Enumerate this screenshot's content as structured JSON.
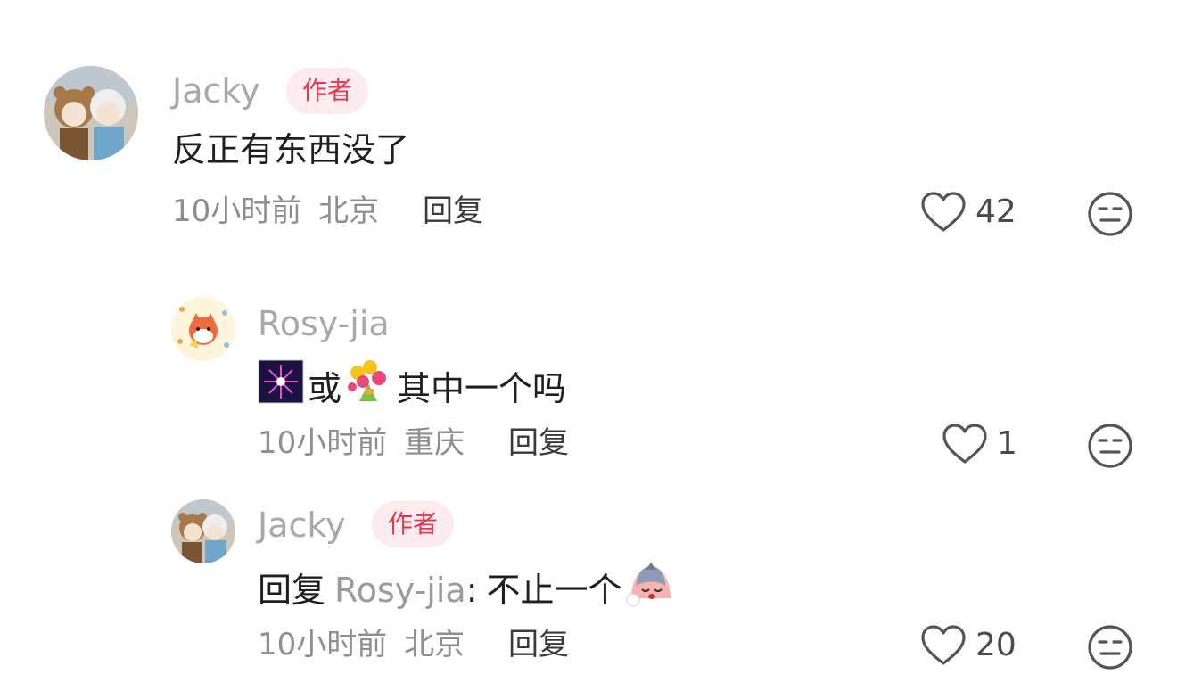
{
  "comments": [
    {
      "author": "Jacky",
      "badge": "作者",
      "text": "反正有东西没了",
      "time": "10小时前",
      "location": "北京",
      "reply_label": "回复",
      "likes": "42"
    },
    {
      "author": "Rosy-jia",
      "text_part1": "或",
      "text_part2": "其中一个吗",
      "time": "10小时前",
      "location": "重庆",
      "reply_label": "回复",
      "likes": "1"
    },
    {
      "author": "Jacky",
      "badge": "作者",
      "reply_prefix": "回复",
      "reply_to": "Rosy-jia",
      "reply_sep": ":",
      "text": "不止一个",
      "time": "10小时前",
      "location": "北京",
      "reply_label": "回复",
      "likes": "20"
    }
  ],
  "colors": {
    "badge_bg": "#fdecef",
    "badge_text": "#e8364f",
    "author": "#a8a8a8",
    "meta": "#8e8e8e"
  }
}
